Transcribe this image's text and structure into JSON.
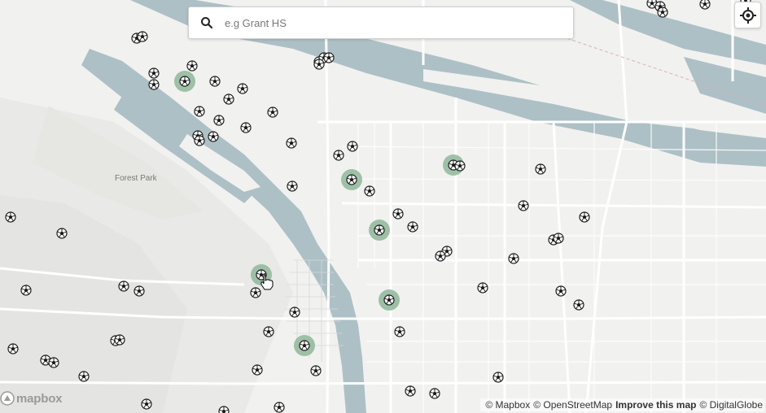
{
  "search": {
    "placeholder": "e.g Grant HS"
  },
  "map": {
    "place_label": "Forest Park",
    "logo_text": "mapbox",
    "attribution": {
      "mapbox": "© Mapbox",
      "osm": "© OpenStreetMap",
      "improve": "Improve this map",
      "digitalglobe": "© DigitalGlobe"
    }
  },
  "colors": {
    "land": "#f1f1f0",
    "water": "#adc0c6",
    "road": "#ffffff",
    "highlight": "#8fb79a",
    "marker": "#1c1c1c"
  },
  "icons": {
    "search": "search-icon",
    "locate": "crosshair-icon",
    "marker": "soccer-ball-icon",
    "cursor": "hand-cursor-icon"
  }
}
